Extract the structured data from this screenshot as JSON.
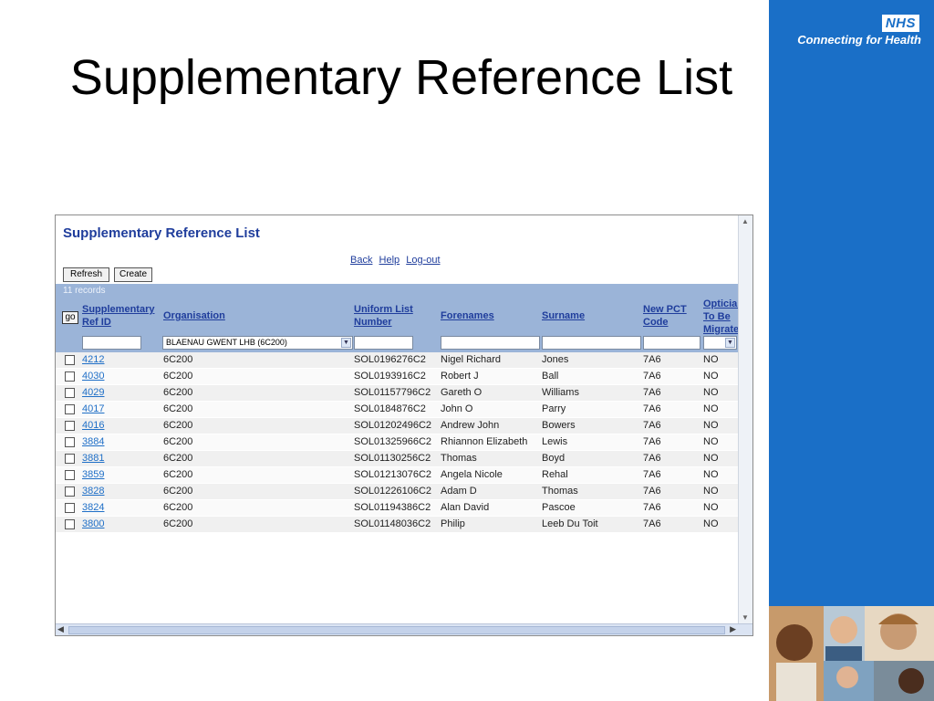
{
  "slide": {
    "title": "Supplementary Reference List"
  },
  "brand": {
    "badge": "NHS",
    "tagline": "Connecting for Health"
  },
  "app": {
    "title": "Supplementary Reference List",
    "links": [
      "Back",
      "Help",
      "Log-out"
    ],
    "buttons": {
      "refresh": "Refresh",
      "create": "Create",
      "go": "go"
    },
    "records": "11 records",
    "columns": {
      "id": [
        "Supplementary",
        "Ref ID"
      ],
      "org": [
        "Organisation"
      ],
      "ulist": [
        "Uniform List",
        "Number"
      ],
      "fore": [
        "Forenames"
      ],
      "sur": [
        "Surname"
      ],
      "pct": [
        "New PCT",
        "Code"
      ],
      "opt": [
        "Optician",
        "To Be",
        "Migrated"
      ]
    },
    "filters": {
      "organisation": "BLAENAU GWENT LHB (6C200)"
    },
    "rows": [
      [
        "4212",
        "6C200",
        "SOL0196276C2",
        "Nigel Richard",
        "Jones",
        "7A6",
        "NO"
      ],
      [
        "4030",
        "6C200",
        "SOL0193916C2",
        "Robert J",
        "Ball",
        "7A6",
        "NO"
      ],
      [
        "4029",
        "6C200",
        "SOL01157796C2",
        "Gareth O",
        "Williams",
        "7A6",
        "NO"
      ],
      [
        "4017",
        "6C200",
        "SOL0184876C2",
        "John O",
        "Parry",
        "7A6",
        "NO"
      ],
      [
        "4016",
        "6C200",
        "SOL01202496C2",
        "Andrew John",
        "Bowers",
        "7A6",
        "NO"
      ],
      [
        "3884",
        "6C200",
        "SOL01325966C2",
        "Rhiannon Elizabeth",
        "Lewis",
        "7A6",
        "NO"
      ],
      [
        "3881",
        "6C200",
        "SOL01130256C2",
        "Thomas",
        "Boyd",
        "7A6",
        "NO"
      ],
      [
        "3859",
        "6C200",
        "SOL01213076C2",
        "Angela Nicole",
        "Rehal",
        "7A6",
        "NO"
      ],
      [
        "3828",
        "6C200",
        "SOL01226106C2",
        "Adam D",
        "Thomas",
        "7A6",
        "NO"
      ],
      [
        "3824",
        "6C200",
        "SOL01194386C2",
        "Alan David",
        "Pascoe",
        "7A6",
        "NO"
      ],
      [
        "3800",
        "6C200",
        "SOL01148036C2",
        "Philip",
        "Leeb Du Toit",
        "7A6",
        "NO"
      ]
    ]
  }
}
